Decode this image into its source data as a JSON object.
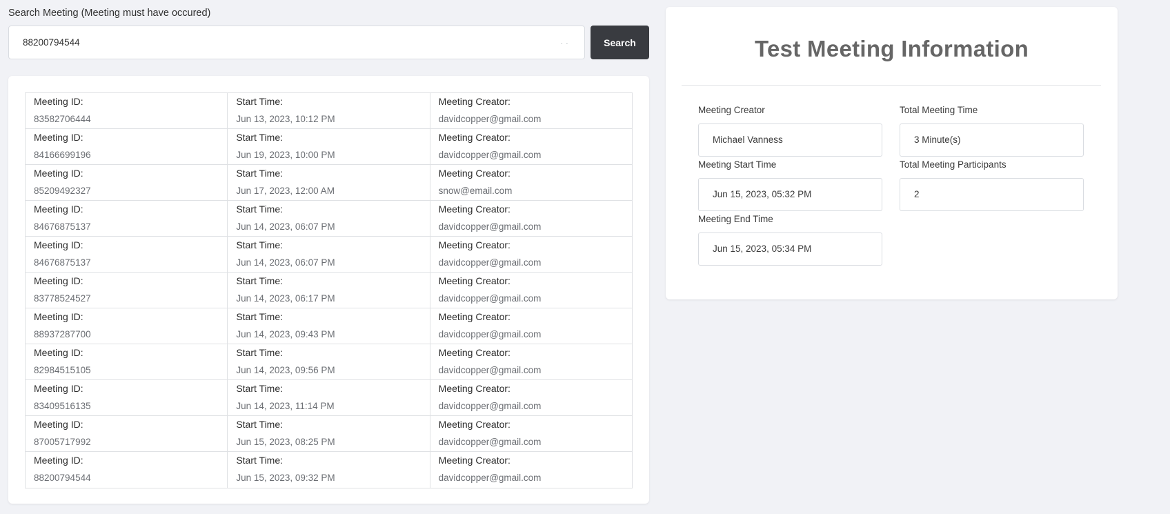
{
  "search": {
    "label": "Search Meeting (Meeting must have occured)",
    "value": "88200794544",
    "spinner": ". .",
    "button_label": "Search"
  },
  "results": {
    "labels": {
      "id": "Meeting ID:",
      "start": "Start Time:",
      "creator": "Meeting Creator:"
    },
    "rows": [
      {
        "id": "83582706444",
        "start": "Jun 13, 2023, 10:12 PM",
        "creator": "davidcopper@gmail.com"
      },
      {
        "id": "84166699196",
        "start": "Jun 19, 2023, 10:00 PM",
        "creator": "davidcopper@gmail.com"
      },
      {
        "id": "85209492327",
        "start": "Jun 17, 2023, 12:00 AM",
        "creator": "snow@email.com"
      },
      {
        "id": "84676875137",
        "start": "Jun 14, 2023, 06:07 PM",
        "creator": "davidcopper@gmail.com"
      },
      {
        "id": "84676875137",
        "start": "Jun 14, 2023, 06:07 PM",
        "creator": "davidcopper@gmail.com"
      },
      {
        "id": "83778524527",
        "start": "Jun 14, 2023, 06:17 PM",
        "creator": "davidcopper@gmail.com"
      },
      {
        "id": "88937287700",
        "start": "Jun 14, 2023, 09:43 PM",
        "creator": "davidcopper@gmail.com"
      },
      {
        "id": "82984515105",
        "start": "Jun 14, 2023, 09:56 PM",
        "creator": "davidcopper@gmail.com"
      },
      {
        "id": "83409516135",
        "start": "Jun 14, 2023, 11:14 PM",
        "creator": "davidcopper@gmail.com"
      },
      {
        "id": "87005717992",
        "start": "Jun 15, 2023, 08:25 PM",
        "creator": "davidcopper@gmail.com"
      },
      {
        "id": "88200794544",
        "start": "Jun 15, 2023, 09:32 PM",
        "creator": "davidcopper@gmail.com"
      }
    ]
  },
  "info": {
    "title": "Test Meeting Information",
    "creator_label": "Meeting Creator",
    "creator_value": "Michael Vanness",
    "total_time_label": "Total Meeting Time",
    "total_time_value": "3 Minute(s)",
    "start_label": "Meeting Start Time",
    "start_value": "Jun 15, 2023, 05:32 PM",
    "participants_label": "Total Meeting Participants",
    "participants_value": "2",
    "end_label": "Meeting End Time",
    "end_value": "Jun 15, 2023, 05:34 PM"
  }
}
